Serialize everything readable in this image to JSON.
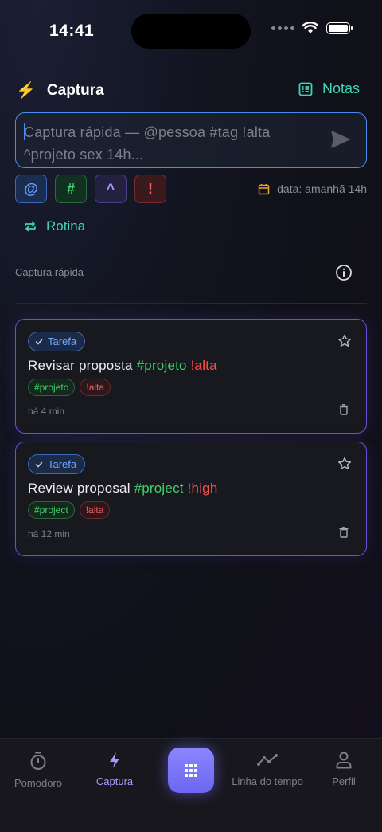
{
  "status_bar": {
    "time": "14:41"
  },
  "header": {
    "title": "Captura",
    "notes_label": "Notas"
  },
  "capture": {
    "placeholder": "Captura rápida — @pessoa #tag !alta ^projeto sex 14h...",
    "tokens": [
      "@",
      "#",
      "^",
      "!"
    ],
    "date_hint": "data: amanhã 14h"
  },
  "routine_label": "Rotina",
  "section_label": "Captura rápida",
  "cards": [
    {
      "badge": "Tarefa",
      "title_plain": "Revisar proposta ",
      "title_tag": "#projeto",
      "title_priority": " !alta",
      "chips": [
        "#projeto",
        "!alta"
      ],
      "time_ago": "há 4 min"
    },
    {
      "badge": "Tarefa",
      "title_plain": "Review proposal ",
      "title_tag": "#project",
      "title_priority": " !high",
      "chips": [
        "#project",
        "!alta"
      ],
      "time_ago": "há 12 min"
    }
  ],
  "nav": {
    "items": [
      "Pomodoro",
      "Captura",
      "Linha do tempo",
      "Perfil"
    ],
    "active": "Captura"
  },
  "colors": {
    "accent_teal": "#3ed4b8",
    "accent_purple": "#a99aff",
    "tag_green": "#3ecf6a",
    "priority_red": "#ff4d4d",
    "input_border": "#4a8cf0"
  },
  "icons": [
    "lightning-icon",
    "notes-icon",
    "send-icon",
    "calendar-icon",
    "repeat-icon",
    "info-icon",
    "check-icon",
    "star-icon",
    "trash-icon",
    "stopwatch-icon",
    "grid-icon",
    "timeline-icon",
    "person-icon",
    "wifi-icon",
    "battery-icon"
  ]
}
